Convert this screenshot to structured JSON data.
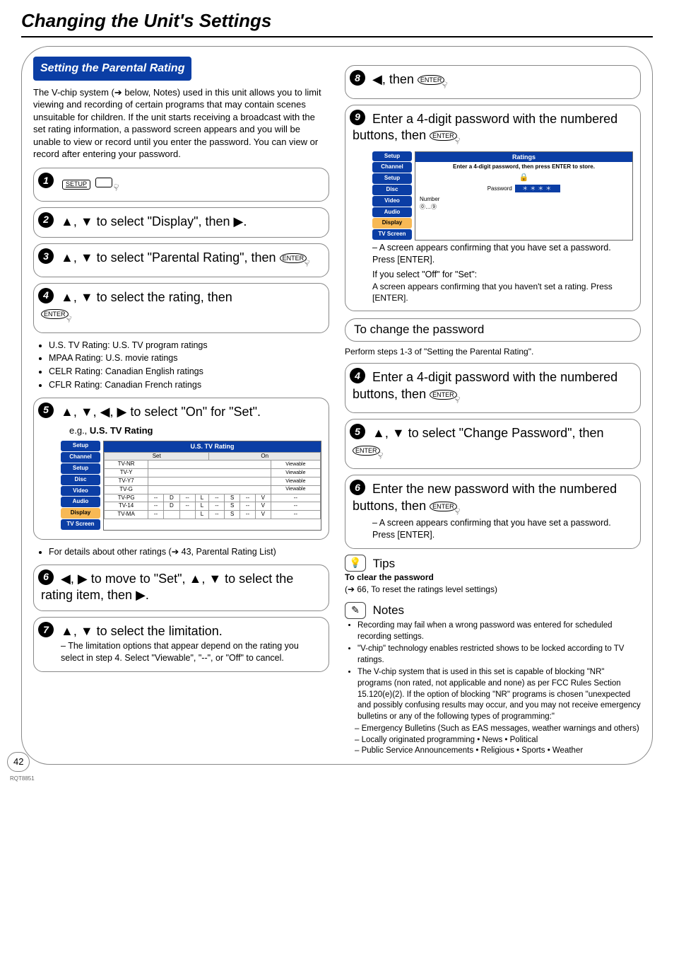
{
  "title": "Changing the Unit's Settings",
  "section": "Setting the Parental Rating",
  "intro": "The V-chip system (➔ below, Notes) used in this unit allows you to limit viewing and recording of certain programs that may contain scenes unsuitable for children. If the unit starts receiving a broadcast with the set rating information, a password screen appears and you will be unable to view or record until you enter the password. You can view or record after entering your password.",
  "enter": "ENTER",
  "setup": "SETUP",
  "steps": {
    "s2": "▲, ▼ to select \"Display\", then ▶.",
    "s3a": "▲, ▼ to select \"Parental Rating\", then ",
    "s4": "▲, ▼ to select the rating, then",
    "s5": "▲, ▼, ◀, ▶ to select \"On\" for \"Set\".",
    "s6": "◀, ▶ to move to \"Set\", ▲, ▼ to select the rating item, then ▶.",
    "s7": "▲, ▼ to select the limitation.",
    "s7n": "– The limitation options that appear depend on the rating you select in step 4. Select \"Viewable\", \"--\", or \"Off\" to cancel.",
    "s8": "◀, then ",
    "s9": "Enter a 4-digit password with the numbered buttons, then ",
    "s9n1": "– A screen appears confirming that you have set a password. Press [ENTER].",
    "s9n2": "If you select \"Off\" for \"Set\":",
    "s9n3": "A screen appears confirming that you haven't set a rating. Press [ENTER]."
  },
  "ratings": [
    "U.S. TV Rating: U.S. TV program ratings",
    "MPAA Rating: U.S. movie ratings",
    "CELR Rating: Canadian English ratings",
    "CFLR Rating: Canadian French ratings"
  ],
  "eg": "e.g., U.S. TV Rating",
  "details": "For details about other ratings (➔ 43, Parental Rating List)",
  "changehdr": "To change the password",
  "changeintro": "Perform steps 1-3 of \"Setting the Parental Rating\".",
  "c4": "Enter a 4-digit password with the numbered buttons, then ",
  "c5": "▲, ▼ to select \"Change Password\", then ",
  "c6": "Enter the new password with the numbered buttons, then ",
  "c6n": "– A screen appears confirming that you have set a password. Press [ENTER].",
  "tipslabel": "Tips",
  "tip1": "To clear the password",
  "tip2": "(➔ 66, To reset the ratings level settings)",
  "noteslabel": "Notes",
  "notes": [
    "Recording may fail when a wrong password was entered for scheduled recording settings.",
    "\"V-chip\" technology enables restricted shows to be locked according to TV ratings.",
    "The V-chip system that is used in this set is capable of blocking \"NR\" programs (non rated, not applicable and none) as per FCC Rules Section 15.120(e)(2). If the option of blocking \"NR\" programs is chosen \"unexpected and possibly confusing results may occur, and you may not receive emergency bulletins or any of the following types of programming:\""
  ],
  "notesub": [
    "– Emergency Bulletins (Such as EAS messages, weather warnings and others)",
    "– Locally originated programming • News • Political",
    "– Public Service Announcements • Religious • Sports • Weather"
  ],
  "pnum": "42",
  "rqt": "RQT8851",
  "osd1": {
    "side": [
      "Setup",
      "Channel",
      "Setup",
      "Disc",
      "Video",
      "Audio",
      "Display",
      "TV Screen"
    ],
    "hdr": "U.S. TV Rating",
    "set": "Set",
    "on": "On",
    "rows": [
      [
        "TV-NR",
        "",
        "",
        "",
        "",
        "",
        "",
        "",
        "Viewable"
      ],
      [
        "TV-Y",
        "",
        "",
        "",
        "",
        "",
        "",
        "",
        "Viewable"
      ],
      [
        "TV-Y7",
        "",
        "",
        "",
        "",
        "",
        "",
        "",
        "Viewable"
      ],
      [
        "TV-G",
        "",
        "",
        "",
        "",
        "",
        "",
        "",
        "Viewable"
      ],
      [
        "TV-PG",
        "--",
        "D",
        "--",
        "L",
        "--",
        "S",
        "--",
        "V",
        "--"
      ],
      [
        "TV-14",
        "--",
        "D",
        "--",
        "L",
        "--",
        "S",
        "--",
        "V",
        "--"
      ],
      [
        "TV-MA",
        "--",
        "",
        "",
        "L",
        "--",
        "S",
        "--",
        "V",
        "--"
      ]
    ]
  },
  "osd2": {
    "hdr": "Ratings",
    "line": "Enter a 4-digit password, then press ENTER to store.",
    "pw": "Password",
    "num": "Number"
  }
}
